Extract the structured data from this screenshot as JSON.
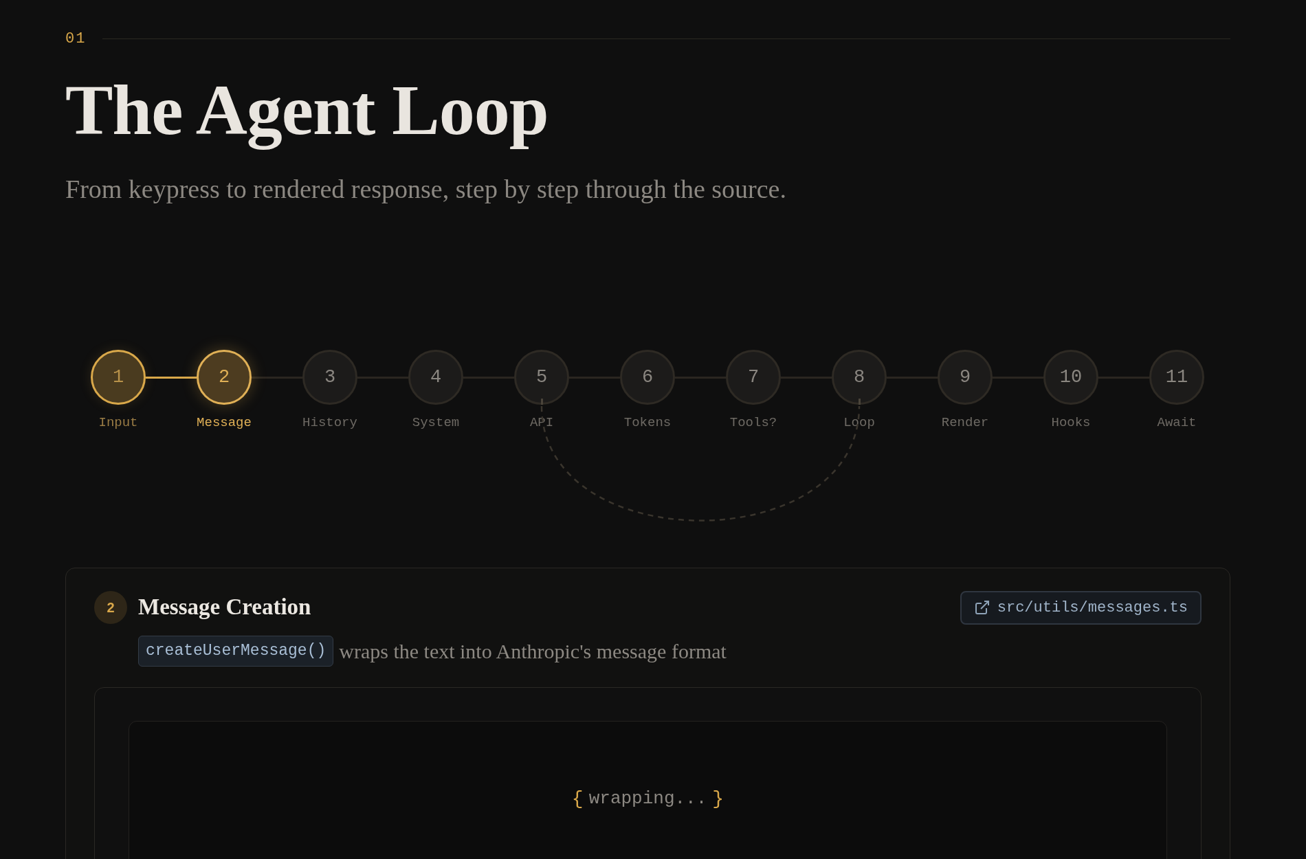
{
  "section": {
    "number": "01"
  },
  "title": "The Agent Loop",
  "subtitle": "From keypress to rendered response, step by step through the source.",
  "steps": [
    {
      "number": "1",
      "label": "Input",
      "done": true,
      "selected": false,
      "loop_anchor": false
    },
    {
      "number": "2",
      "label": "Message",
      "done": false,
      "selected": true,
      "loop_anchor": false
    },
    {
      "number": "3",
      "label": "History",
      "done": false,
      "selected": false,
      "loop_anchor": false
    },
    {
      "number": "4",
      "label": "System",
      "done": false,
      "selected": false,
      "loop_anchor": false
    },
    {
      "number": "5",
      "label": "API",
      "done": false,
      "selected": false,
      "loop_anchor": true
    },
    {
      "number": "6",
      "label": "Tokens",
      "done": false,
      "selected": false,
      "loop_anchor": false
    },
    {
      "number": "7",
      "label": "Tools?",
      "done": false,
      "selected": false,
      "loop_anchor": false
    },
    {
      "number": "8",
      "label": "Loop",
      "done": false,
      "selected": false,
      "loop_anchor": true
    },
    {
      "number": "9",
      "label": "Render",
      "done": false,
      "selected": false,
      "loop_anchor": false
    },
    {
      "number": "10",
      "label": "Hooks",
      "done": false,
      "selected": false,
      "loop_anchor": false
    },
    {
      "number": "11",
      "label": "Await",
      "done": false,
      "selected": false,
      "loop_anchor": false
    }
  ],
  "detail": {
    "step_badge": "2",
    "title": "Message Creation",
    "source_link": "src/utils/messages.ts",
    "code": "createUserMessage()",
    "description": "wraps the text into Anthropic's message format",
    "preview": {
      "open_brace": "{",
      "text": "wrapping...",
      "close_brace": "}"
    }
  }
}
